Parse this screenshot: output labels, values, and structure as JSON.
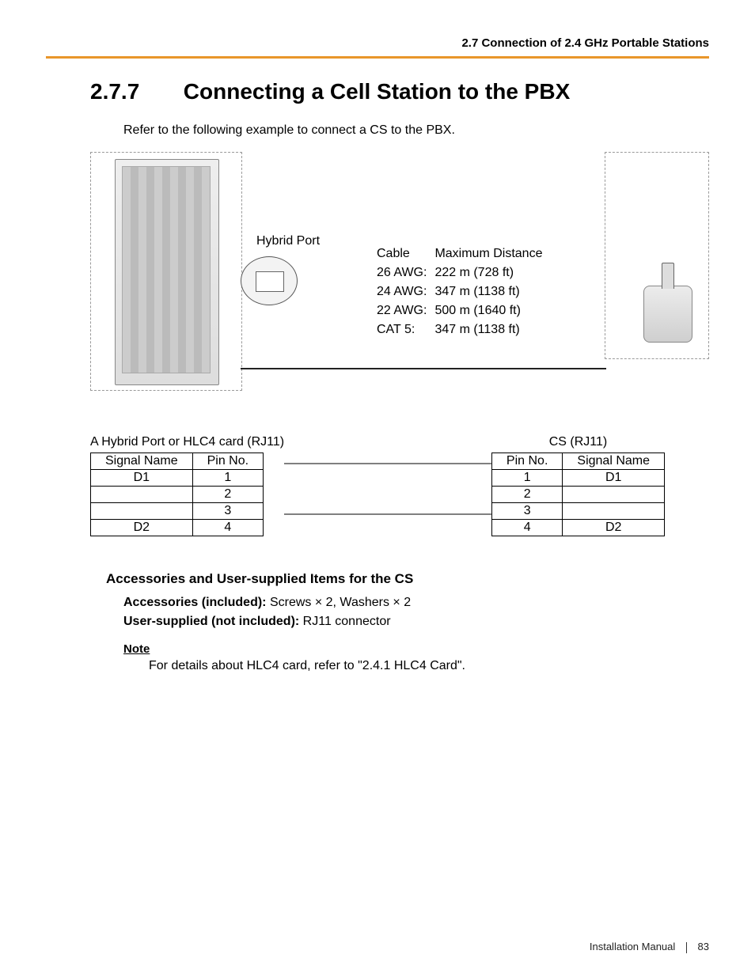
{
  "header": {
    "running": "2.7 Connection of 2.4 GHz Portable Stations"
  },
  "section": {
    "number": "2.7.7",
    "title": "Connecting a Cell Station to the PBX"
  },
  "intro": "Refer to the following example to connect a CS to the PBX.",
  "diagram": {
    "port_label": "Hybrid Port",
    "cable_heading": "Cable",
    "distance_heading": "Maximum Distance",
    "rows": [
      {
        "gauge": "26 AWG:",
        "dist": "222 m (728 ft)"
      },
      {
        "gauge": "24 AWG:",
        "dist": "347 m (1138 ft)"
      },
      {
        "gauge": "22 AWG:",
        "dist": "500 m (1640 ft)"
      },
      {
        "gauge": "CAT 5:",
        "dist": "347 m (1138 ft)"
      }
    ]
  },
  "pinout": {
    "left_caption": "A Hybrid Port or HLC4 card (RJ11)",
    "right_caption": "CS (RJ11)",
    "cols": {
      "signal": "Signal Name",
      "pin": "Pin No."
    },
    "left": [
      {
        "signal": "D1",
        "pin": "1"
      },
      {
        "signal": "",
        "pin": "2"
      },
      {
        "signal": "",
        "pin": "3"
      },
      {
        "signal": "D2",
        "pin": "4"
      }
    ],
    "right": [
      {
        "pin": "1",
        "signal": "D1"
      },
      {
        "pin": "2",
        "signal": ""
      },
      {
        "pin": "3",
        "signal": ""
      },
      {
        "pin": "4",
        "signal": "D2"
      }
    ]
  },
  "accessories": {
    "heading": "Accessories and User-supplied Items for the CS",
    "included_label": "Accessories (included): ",
    "included_text": "Screws × 2, Washers × 2",
    "user_label": "User-supplied (not included): ",
    "user_text": "RJ11 connector",
    "note_label": "Note",
    "note_text": "For details about HLC4 card, refer to \"2.4.1 HLC4 Card\"."
  },
  "footer": {
    "doc": "Installation Manual",
    "page": "83"
  }
}
